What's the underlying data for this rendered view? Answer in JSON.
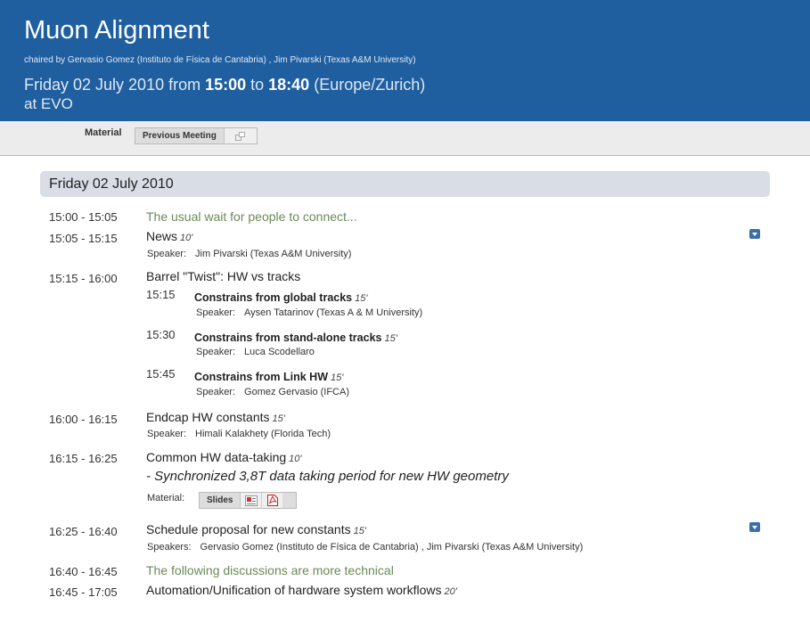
{
  "event": {
    "title": "Muon Alignment",
    "chairs": "chaired by Gervasio Gomez (Instituto de Física de Cantabria) , Jim Pivarski (Texas A&M University)",
    "date_prefix": "Friday 02 July 2010 from ",
    "start": "15:00",
    "to": " to ",
    "end": "18:40",
    "timezone": " (Europe/Zurich)",
    "location": "at EVO"
  },
  "material": {
    "label": "Material",
    "previous_meeting": "Previous Meeting"
  },
  "day": {
    "header": "Friday 02 July 2010"
  },
  "items": [
    {
      "time": "15:00 - 15:05",
      "break": "The usual wait for people to connect..."
    },
    {
      "time": "15:05 - 15:15",
      "title": "News",
      "duration": "10'",
      "speaker_key": "Speaker:",
      "speaker": "Jim Pivarski (Texas A&M University)"
    },
    {
      "time": "15:15 - 16:00",
      "title": "Barrel \"Twist\": HW vs tracks",
      "subs": [
        {
          "time": "15:15",
          "title": "Constrains from global tracks",
          "duration": "15'",
          "speaker_key": "Speaker:",
          "speaker": "Aysen Tatarinov (Texas A & M University)"
        },
        {
          "time": "15:30",
          "title": "Constrains from stand-alone tracks",
          "duration": "15'",
          "speaker_key": "Speaker:",
          "speaker": "Luca Scodellaro"
        },
        {
          "time": "15:45",
          "title": "Constrains from Link HW",
          "duration": "15'",
          "speaker_key": "Speaker:",
          "speaker": "Gomez Gervasio (IFCA)"
        }
      ]
    },
    {
      "time": "16:00 - 16:15",
      "title": "Endcap HW constants",
      "duration": "15'",
      "speaker_key": "Speaker:",
      "speaker": "Himali Kalakhety (Florida Tech)"
    },
    {
      "time": "16:15 - 16:25",
      "title": "Common HW data-taking",
      "duration": "10'",
      "description": "- Synchronized 3,8T data taking period for new HW geometry",
      "material_key": "Material:",
      "slides": "Slides"
    },
    {
      "time": "16:25 - 16:40",
      "title": "Schedule proposal for new constants",
      "duration": "15'",
      "speaker_key": "Speakers:",
      "speaker": "Gervasio Gomez (Instituto de Física de Cantabria) , Jim Pivarski (Texas A&M University)"
    },
    {
      "time": "16:40 - 16:45",
      "break": "The following discussions are more technical"
    },
    {
      "time": "16:45 - 17:05",
      "title": "Automation/Unification of hardware system workflows",
      "duration": "20'"
    }
  ]
}
